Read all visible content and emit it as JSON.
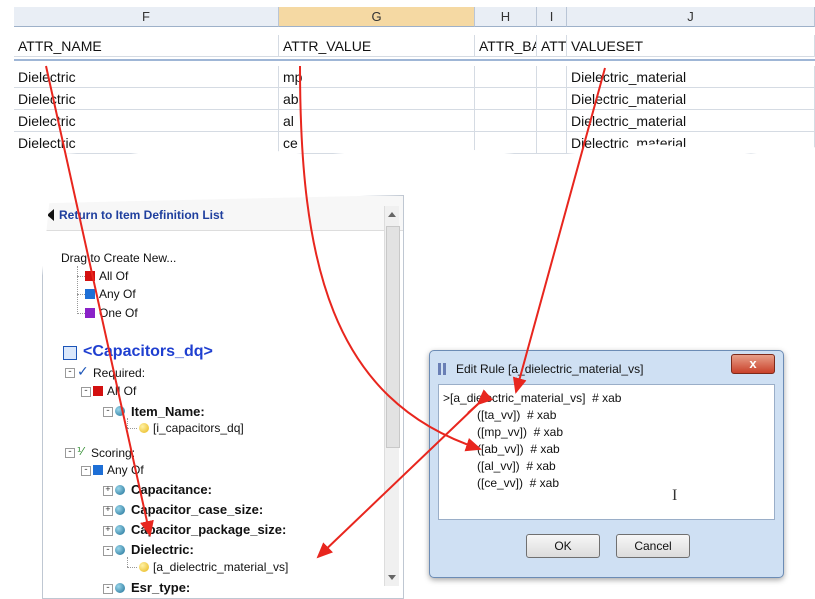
{
  "sheet": {
    "columns": [
      "F",
      "G",
      "H",
      "I",
      "J"
    ],
    "headers": [
      "ATTR_NAME",
      "ATTR_VALUE",
      "ATTR_BA",
      "ATTR",
      "VALUESET"
    ],
    "rows": [
      [
        "Dielectric",
        "mp",
        "",
        "",
        "Dielectric_material"
      ],
      [
        "Dielectric",
        "ab",
        "",
        "",
        "Dielectric_material"
      ],
      [
        "Dielectric",
        "al",
        "",
        "",
        "Dielectric_material"
      ],
      [
        "Dielectric",
        "ce",
        "",
        "",
        "Dielectric_material"
      ]
    ]
  },
  "tree": {
    "back_label": "Return to Item Definition List",
    "drag_label": "Drag to Create New...",
    "new_items": [
      "All Of",
      "Any Of",
      "One Of"
    ],
    "root": "<Capacitors_dq>",
    "required": "Required:",
    "req_allof": "All Of",
    "item_name": "Item_Name:",
    "item_name_val": "[i_capacitors_dq]",
    "scoring": "Scoring:",
    "score_anyof": "Any Of",
    "attrs": [
      "Capacitance:",
      "Capacitor_case_size:",
      "Capacitor_package_size:",
      "Dielectric:"
    ],
    "dielectric_val": "[a_dielectric_material_vs]",
    "esr": "Esr_type:"
  },
  "dialog": {
    "title": "Edit Rule [a_dielectric_material_vs]",
    "close": "x",
    "lines": [
      ">[a_dielectric_material_vs]  # xab",
      "([ta_vv])  # xab",
      "([mp_vv])  # xab",
      "([ab_vv])  # xab",
      "([al_vv])  # xab",
      "([ce_vv])  # xab"
    ],
    "ok": "OK",
    "cancel": "Cancel"
  },
  "colors": {
    "arrow": "#e8261e",
    "link": "#1f3f9e",
    "header_sel": "#f5d9a3"
  }
}
